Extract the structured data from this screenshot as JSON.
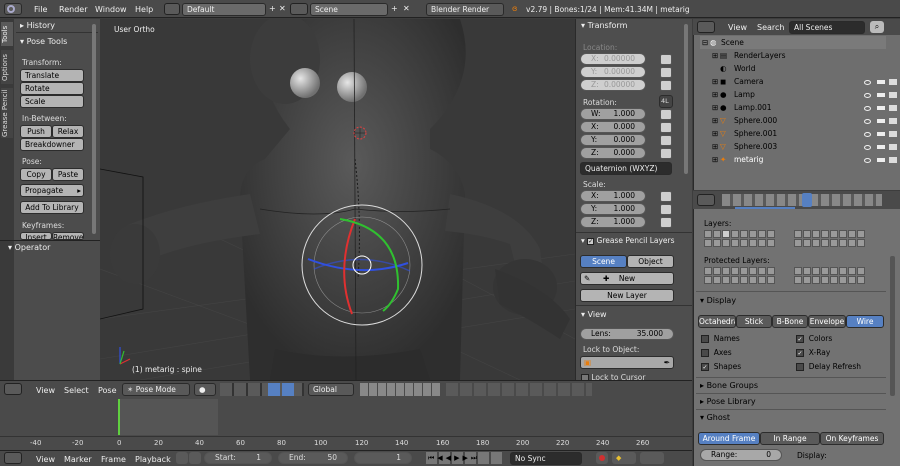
{
  "topbar": {
    "menus": [
      "File",
      "Render",
      "Window",
      "Help"
    ],
    "screen": "Default",
    "scene": "Scene",
    "engine": "Blender Render",
    "stats": "v2.79 | Bones:1/24 | Mem:41.34M | metarig"
  },
  "tools": {
    "tabs": [
      "Tools",
      "Options",
      "Grease Pencil"
    ],
    "history": "History",
    "pose_tools": "Pose Tools",
    "transform_label": "Transform:",
    "translate": "Translate",
    "rotate": "Rotate",
    "scale": "Scale",
    "inbetween_label": "In-Between:",
    "push": "Push",
    "relax": "Relax",
    "breakdowner": "Breakdowner",
    "pose_label": "Pose:",
    "copy": "Copy",
    "paste": "Paste",
    "propagate": "Propagate",
    "add_library": "Add To Library",
    "keyframes_label": "Keyframes:",
    "insert": "Insert",
    "remove": "Remove",
    "operator": "Operator"
  },
  "viewport": {
    "view_name": "User Ortho",
    "status": "(1) metarig : spine"
  },
  "npanel": {
    "transform": "Transform",
    "location": "Location:",
    "loc": [
      {
        "k": "X:",
        "v": "0.00000"
      },
      {
        "k": "Y:",
        "v": "0.00000"
      },
      {
        "k": "Z:",
        "v": "0.00000"
      }
    ],
    "rotation": "Rotation:",
    "rot_mode_btn": "4L",
    "rot": [
      {
        "k": "W:",
        "v": "1.000"
      },
      {
        "k": "X:",
        "v": "0.000"
      },
      {
        "k": "Y:",
        "v": "0.000"
      },
      {
        "k": "Z:",
        "v": "0.000"
      }
    ],
    "rot_mode": "Quaternion (WXYZ)",
    "scale": "Scale:",
    "scl": [
      {
        "k": "X:",
        "v": "1.000"
      },
      {
        "k": "Y:",
        "v": "1.000"
      },
      {
        "k": "Z:",
        "v": "1.000"
      }
    ],
    "gp_layers": "Grease Pencil Layers",
    "scene_btn": "Scene",
    "object_btn": "Object",
    "new": "New",
    "new_layer": "New Layer",
    "view": "View",
    "lens_label": "Lens:",
    "lens_value": "35.000",
    "lock_to_object": "Lock to Object:",
    "lock_to_cursor": "Lock to Cursor"
  },
  "outliner": {
    "view": "View",
    "search": "Search",
    "filter": "All Scenes",
    "scene": "Scene",
    "items": [
      "RenderLayers",
      "World",
      "Camera",
      "Lamp",
      "Lamp.001",
      "Sphere.000",
      "Sphere.001",
      "Sphere.003",
      "metarig"
    ]
  },
  "properties": {
    "layers": "Layers:",
    "protected_layers": "Protected Layers:",
    "display": "Display",
    "display_tabs": [
      "Octahedral",
      "Stick",
      "B-Bone",
      "Envelope",
      "Wire"
    ],
    "names": "Names",
    "axes": "Axes",
    "shapes": "Shapes",
    "colors": "Colors",
    "xray": "X-Ray",
    "delay_refresh": "Delay Refresh",
    "bone_groups": "Bone Groups",
    "pose_library": "Pose Library",
    "ghost": "Ghost",
    "ghost_tabs": [
      "Around Frame",
      "In Range",
      "On Keyframes"
    ],
    "range_label": "Range:",
    "range_value": "0",
    "display_label": "Display:"
  },
  "view3d_header": {
    "view": "View",
    "select": "Select",
    "pose": "Pose",
    "mode": "Pose Mode",
    "orientation": "Global"
  },
  "timeline": {
    "ticks": [
      "-40",
      "-20",
      "0",
      "20",
      "40",
      "60",
      "80",
      "100",
      "120",
      "140",
      "160",
      "180",
      "200",
      "220",
      "240",
      "260"
    ],
    "menus": [
      "View",
      "Marker",
      "Frame",
      "Playback"
    ],
    "start_label": "Start:",
    "start": "1",
    "end_label": "End:",
    "end": "50",
    "current": "1",
    "sync": "No Sync"
  },
  "colors": {
    "accent": "#5680c2",
    "selected_bone": "#f0a030"
  }
}
